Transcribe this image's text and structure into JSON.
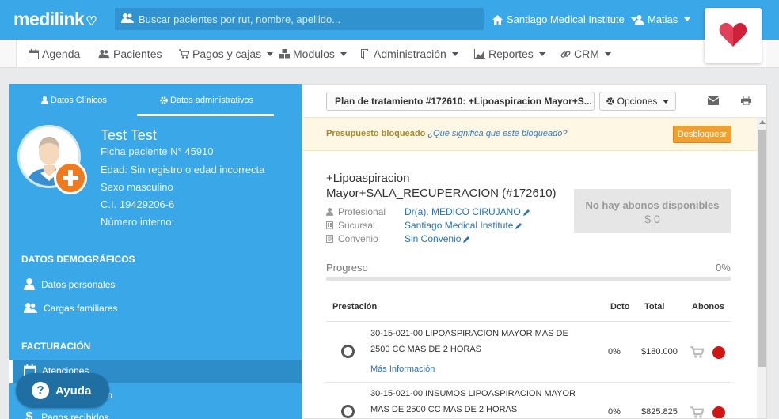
{
  "app": {
    "logo": "medilink",
    "search_placeholder": "Buscar pacientes por rut, nombre, apellido...",
    "institution": "Santiago Medical Institute",
    "user": "Matias"
  },
  "nav": [
    "Agenda",
    "Pacientes",
    "Pagos y cajas",
    "Modulos",
    "Administración",
    "Reportes",
    "CRM"
  ],
  "left": {
    "tabs": [
      "Datos Clínicos",
      "Datos administrativos"
    ],
    "patient": {
      "name": "Test Test",
      "ficha": "Ficha paciente N° 45910",
      "edad": "Edad: Sin registro o edad incorrecta",
      "sexo": "Sexo masculino",
      "ci": "C.I. 19429206-6",
      "interno": "Número interno:"
    },
    "sections": {
      "demograficos": "DATOS DEMOGRÁFICOS",
      "facturacion": "FACTURACIÓN"
    },
    "items": {
      "personales": "Datos personales",
      "cargas": "Cargas familiares",
      "atenciones": "Atenciones",
      "pago": "ago",
      "recibidos": "Pagos recibidos"
    },
    "help": "Ayuda"
  },
  "right": {
    "plan_button": "Plan de tratamiento #172610: +Lipoaspiracion Mayor+S...",
    "options": "Opciones",
    "lock_label": "Presupuesto bloqueado",
    "lock_question": "¿Qué significa que esté bloqueado?",
    "unlock": "Desbloquear",
    "plan_title_1": "+Lipoaspiracion",
    "plan_title_2": "Mayor+SALA_RECUPERACION (#172610)",
    "details": [
      {
        "label": "Profesional",
        "value": "Dr(a). MEDICO CIRUJANO"
      },
      {
        "label": "Sucursal",
        "value": "Santiago Medical Institute"
      },
      {
        "label": "Convenio",
        "value": "Sin Convenio"
      }
    ],
    "abonos_title": "No hay abonos disponibles",
    "abonos_value": "$ 0",
    "progress_label": "Progreso",
    "progress_pct": "0%",
    "progress_value": 0,
    "columns": {
      "prestacion": "Prestación",
      "dcto": "Dcto",
      "total": "Total",
      "abonos": "Abonos"
    },
    "rows": [
      {
        "desc_1": "30-15-021-00 LIPOASPIRACION MAYOR MAS DE",
        "desc_2": "2500 CC MAS DE 2 HORAS",
        "more": "Más Información",
        "dcto": "0%",
        "total": "$180.000"
      },
      {
        "desc_1": "30-15-021-00 INSUMOS LIPOASPIRACION MAYOR",
        "desc_2": "MAS DE 2500 CC MAS DE 2 HORAS",
        "dcto": "0%",
        "total": "$825.825"
      }
    ]
  },
  "colors": {
    "primary": "#3aa8e8",
    "accent": "#f07a1d",
    "danger": "#d01515",
    "warning": "#f0a030"
  }
}
